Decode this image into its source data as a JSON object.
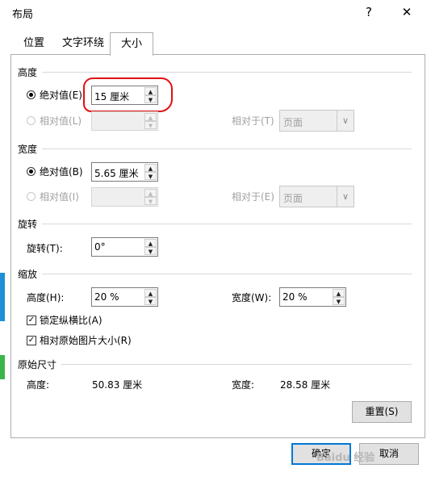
{
  "window": {
    "title": "布局",
    "help_label": "?",
    "close_label": "✕"
  },
  "tabs": [
    {
      "label": "位置",
      "active": false
    },
    {
      "label": "文字环绕",
      "active": false
    },
    {
      "label": "大小",
      "active": true
    }
  ],
  "height_section": {
    "title": "高度",
    "absolute_label": "绝对值(E)",
    "absolute_value": "15 厘米",
    "relative_label": "相对值(L)",
    "relative_to_label": "相对于(T)",
    "relative_to_value": "页面"
  },
  "width_section": {
    "title": "宽度",
    "absolute_label": "绝对值(B)",
    "absolute_value": "5.65 厘米",
    "relative_label": "相对值(I)",
    "relative_to_label": "相对于(E)",
    "relative_to_value": "页面"
  },
  "rotation_section": {
    "title": "旋转",
    "rotation_label": "旋转(T):",
    "rotation_value": "0°"
  },
  "scale_section": {
    "title": "缩放",
    "height_label": "高度(H):",
    "height_value": "20 %",
    "width_label": "宽度(W):",
    "width_value": "20 %",
    "lock_aspect_label": "锁定纵横比(A)",
    "lock_aspect_checked": true,
    "relative_original_label": "相对原始图片大小(R)",
    "relative_original_checked": true
  },
  "original_size_section": {
    "title": "原始尺寸",
    "height_label": "高度:",
    "height_value": "50.83 厘米",
    "width_label": "宽度:",
    "width_value": "28.58 厘米",
    "reset_label": "重置(S)"
  },
  "footer": {
    "ok_label": "确定",
    "cancel_label": "取消"
  },
  "watermark": {
    "text": "Baidu 经验"
  },
  "colors": {
    "accent": "#0078d7",
    "annotation": "#e01010",
    "panel_border": "#adadad"
  },
  "icons": {
    "up_arrow": "▲",
    "down_arrow": "▼",
    "dropdown": "∨",
    "check": "✓"
  }
}
